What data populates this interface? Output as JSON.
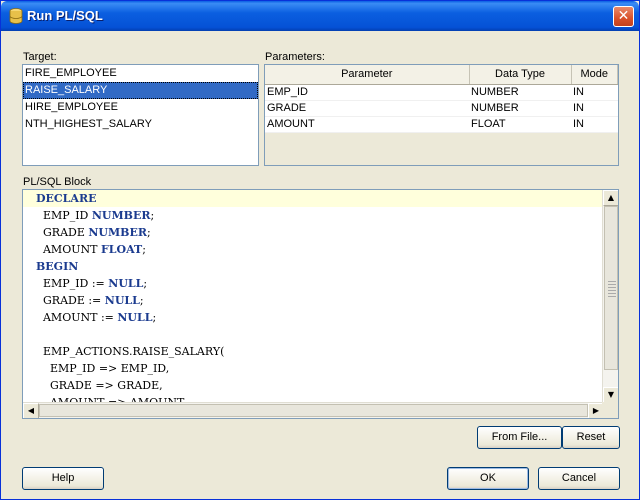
{
  "window": {
    "title": "Run PL/SQL",
    "close_label": "✕"
  },
  "target": {
    "label": "Target:",
    "items": [
      "FIRE_EMPLOYEE",
      "RAISE_SALARY",
      "HIRE_EMPLOYEE",
      "NTH_HIGHEST_SALARY"
    ],
    "selected": "RAISE_SALARY"
  },
  "parameters": {
    "label": "Parameters:",
    "columns": [
      "Parameter",
      "Data Type",
      "Mode"
    ],
    "rows": [
      [
        "EMP_ID",
        "NUMBER",
        "IN"
      ],
      [
        "GRADE",
        "NUMBER",
        "IN"
      ],
      [
        "AMOUNT",
        "FLOAT",
        "IN"
      ]
    ]
  },
  "plsql": {
    "label": "PL/SQL Block",
    "lines": [
      "DECLARE",
      "  EMP_ID NUMBER;",
      "  GRADE NUMBER;",
      "  AMOUNT FLOAT;",
      "BEGIN",
      "  EMP_ID := NULL;",
      "  GRADE := NULL;",
      "  AMOUNT := NULL;",
      "",
      "  EMP_ACTIONS.RAISE_SALARY(",
      "    EMP_ID => EMP_ID,",
      "    GRADE => GRADE,",
      "    AMOUNT => AMOUNT"
    ],
    "keywords": [
      "DECLARE",
      "BEGIN",
      "NUMBER",
      "FLOAT",
      "NULL"
    ]
  },
  "buttons": {
    "from_file": "From File...",
    "reset": "Reset",
    "help": "Help",
    "ok": "OK",
    "cancel": "Cancel"
  }
}
